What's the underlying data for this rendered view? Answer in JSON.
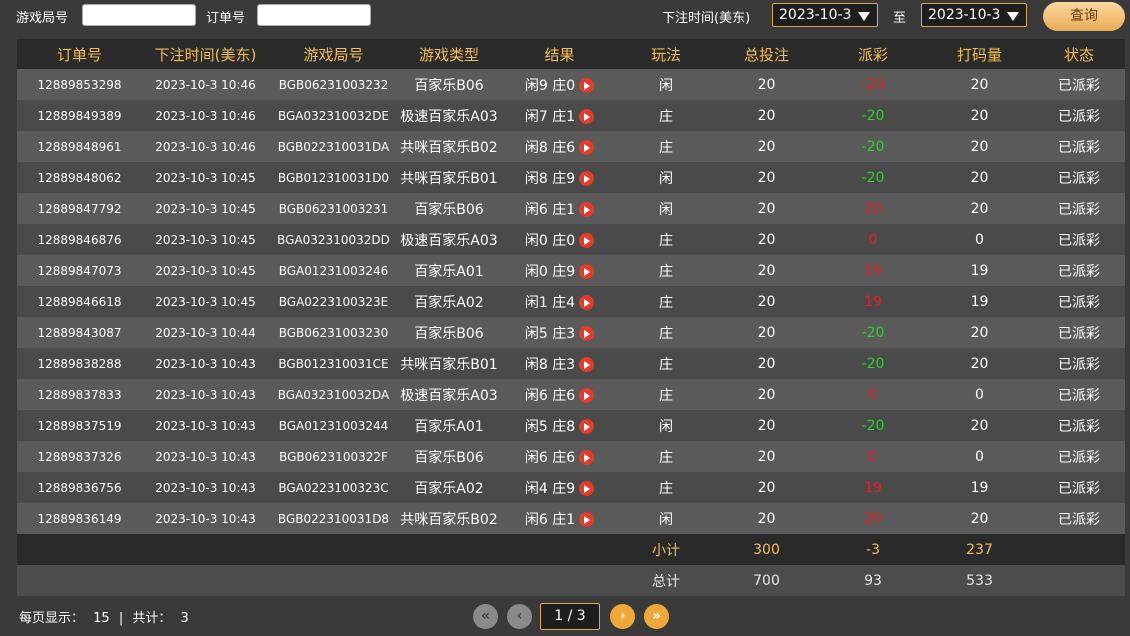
{
  "filters": {
    "game_round_label": "游戏局号",
    "game_round_value": "",
    "order_no_label": "订单号",
    "order_no_value": "",
    "bet_time_label": "下注时间(美东)",
    "date_from": "2023-10-3",
    "to_label": "至",
    "date_to": "2023-10-3",
    "query_label": "查询"
  },
  "table": {
    "headers": [
      "订单号",
      "下注时间(美东)",
      "游戏局号",
      "游戏类型",
      "结果",
      "玩法",
      "总投注",
      "派彩",
      "打码量",
      "状态"
    ],
    "rows": [
      {
        "order": "12889853298",
        "time": "2023-10-3 10:46",
        "round": "BGB06231003232",
        "game": "百家乐B06",
        "result": "闲9 庄0",
        "play": "闲",
        "bet": "20",
        "payout": "-20",
        "payout_sign": "neg",
        "turnover": "20",
        "status": "已派彩"
      },
      {
        "order": "12889849389",
        "time": "2023-10-3 10:46",
        "round": "BGA032310032DE",
        "game": "极速百家乐A03",
        "result": "闲7 庄1",
        "play": "庄",
        "bet": "20",
        "payout": "-20",
        "payout_sign": "pos",
        "turnover": "20",
        "status": "已派彩"
      },
      {
        "order": "12889848961",
        "time": "2023-10-3 10:46",
        "round": "BGB022310031DA",
        "game": "共咪百家乐B02",
        "result": "闲8 庄6",
        "play": "庄",
        "bet": "20",
        "payout": "-20",
        "payout_sign": "pos",
        "turnover": "20",
        "status": "已派彩"
      },
      {
        "order": "12889848062",
        "time": "2023-10-3 10:45",
        "round": "BGB012310031D0",
        "game": "共咪百家乐B01",
        "result": "闲8 庄9",
        "play": "闲",
        "bet": "20",
        "payout": "-20",
        "payout_sign": "pos",
        "turnover": "20",
        "status": "已派彩"
      },
      {
        "order": "12889847792",
        "time": "2023-10-3 10:45",
        "round": "BGB06231003231",
        "game": "百家乐B06",
        "result": "闲6 庄1",
        "play": "闲",
        "bet": "20",
        "payout": "20",
        "payout_sign": "neg",
        "turnover": "20",
        "status": "已派彩"
      },
      {
        "order": "12889846876",
        "time": "2023-10-3 10:45",
        "round": "BGA032310032DD",
        "game": "极速百家乐A03",
        "result": "闲0 庄0",
        "play": "庄",
        "bet": "20",
        "payout": "0",
        "payout_sign": "neg",
        "turnover": "0",
        "status": "已派彩"
      },
      {
        "order": "12889847073",
        "time": "2023-10-3 10:45",
        "round": "BGA01231003246",
        "game": "百家乐A01",
        "result": "闲0 庄9",
        "play": "庄",
        "bet": "20",
        "payout": "19",
        "payout_sign": "neg",
        "turnover": "19",
        "status": "已派彩"
      },
      {
        "order": "12889846618",
        "time": "2023-10-3 10:45",
        "round": "BGA0223100323E",
        "game": "百家乐A02",
        "result": "闲1 庄4",
        "play": "庄",
        "bet": "20",
        "payout": "19",
        "payout_sign": "neg",
        "turnover": "19",
        "status": "已派彩"
      },
      {
        "order": "12889843087",
        "time": "2023-10-3 10:44",
        "round": "BGB06231003230",
        "game": "百家乐B06",
        "result": "闲5 庄3",
        "play": "庄",
        "bet": "20",
        "payout": "-20",
        "payout_sign": "pos",
        "turnover": "20",
        "status": "已派彩"
      },
      {
        "order": "12889838288",
        "time": "2023-10-3 10:43",
        "round": "BGB012310031CE",
        "game": "共咪百家乐B01",
        "result": "闲8 庄3",
        "play": "庄",
        "bet": "20",
        "payout": "-20",
        "payout_sign": "pos",
        "turnover": "20",
        "status": "已派彩"
      },
      {
        "order": "12889837833",
        "time": "2023-10-3 10:43",
        "round": "BGA032310032DA",
        "game": "极速百家乐A03",
        "result": "闲6 庄6",
        "play": "庄",
        "bet": "20",
        "payout": "0",
        "payout_sign": "neg",
        "turnover": "0",
        "status": "已派彩"
      },
      {
        "order": "12889837519",
        "time": "2023-10-3 10:43",
        "round": "BGA01231003244",
        "game": "百家乐A01",
        "result": "闲5 庄8",
        "play": "闲",
        "bet": "20",
        "payout": "-20",
        "payout_sign": "pos",
        "turnover": "20",
        "status": "已派彩"
      },
      {
        "order": "12889837326",
        "time": "2023-10-3 10:43",
        "round": "BGB0623100322F",
        "game": "百家乐B06",
        "result": "闲6 庄6",
        "play": "庄",
        "bet": "20",
        "payout": "0",
        "payout_sign": "neg",
        "turnover": "0",
        "status": "已派彩"
      },
      {
        "order": "12889836756",
        "time": "2023-10-3 10:43",
        "round": "BGA0223100323C",
        "game": "百家乐A02",
        "result": "闲4 庄9",
        "play": "庄",
        "bet": "20",
        "payout": "19",
        "payout_sign": "neg",
        "turnover": "19",
        "status": "已派彩"
      },
      {
        "order": "12889836149",
        "time": "2023-10-3 10:43",
        "round": "BGB022310031D8",
        "game": "共咪百家乐B02",
        "result": "闲6 庄1",
        "play": "闲",
        "bet": "20",
        "payout": "20",
        "payout_sign": "neg",
        "turnover": "20",
        "status": "已派彩"
      }
    ],
    "subtotal": {
      "label": "小计",
      "bet": "300",
      "payout": "-3",
      "payout_sign": "pos",
      "turnover": "237"
    },
    "total": {
      "label": "总计",
      "bet": "700",
      "payout": "93",
      "payout_sign": "neg",
      "turnover": "533"
    }
  },
  "colors": {
    "accent": "#f5bd4f",
    "negative": "#e02020",
    "positive": "#27d427"
  },
  "icons": {
    "result_play": "play-icon",
    "first_page": "double-left-icon",
    "prev_page": "chevron-left-icon",
    "next_page": "chevron-right-icon",
    "last_page": "double-right-icon"
  },
  "footer": {
    "per_page_label": "每页显示：",
    "per_page": "15",
    "separator": "|",
    "total_label": "共计：",
    "total_pages": "3",
    "page_indicator": "1 / 3"
  }
}
